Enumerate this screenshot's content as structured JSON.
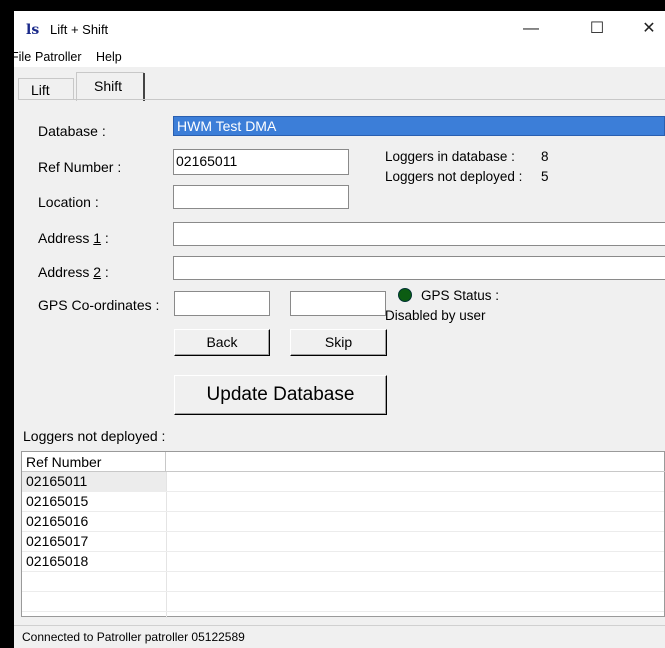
{
  "window": {
    "title": "Lift + Shift",
    "controls": {
      "minimize": "—",
      "maximize": "☐",
      "close": "✕"
    }
  },
  "menu": {
    "file": "File",
    "patroller": "Patroller",
    "help": "Help"
  },
  "tabs": {
    "lift": "Lift",
    "shift": "Shift"
  },
  "form": {
    "database_label": "Database :",
    "database_value": "HWM Test DMA",
    "ref_number_label": "Ref Number :",
    "ref_number_value": "02165011",
    "location_label": "Location :",
    "location_value": "",
    "address1_label_pre": "Address ",
    "address1_label_key": "1",
    "address1_label_post": " :",
    "address1_value": "",
    "address2_label_pre": "Address ",
    "address2_label_key": "2",
    "address2_label_post": " :",
    "address2_value": "",
    "gps_label": "GPS Co-ordinates :",
    "gps_lat_value": "",
    "gps_lon_value": ""
  },
  "info": {
    "loggers_in_db_label": "Loggers in database :",
    "loggers_in_db_value": "8",
    "loggers_not_deployed_label": "Loggers not deployed :",
    "loggers_not_deployed_value": "5",
    "gps_status_label": "GPS Status :",
    "gps_status_value": "Disabled by user",
    "gps_status_color": "#0c5c12"
  },
  "buttons": {
    "back": "Back",
    "skip": "Skip",
    "update": "Update Database"
  },
  "list": {
    "heading": "Loggers not deployed :",
    "column": "Ref Number",
    "rows": [
      "02165011",
      "02165015",
      "02165016",
      "02165017",
      "02165018"
    ]
  },
  "status": {
    "text": "Connected to Patroller patroller 05122589"
  }
}
